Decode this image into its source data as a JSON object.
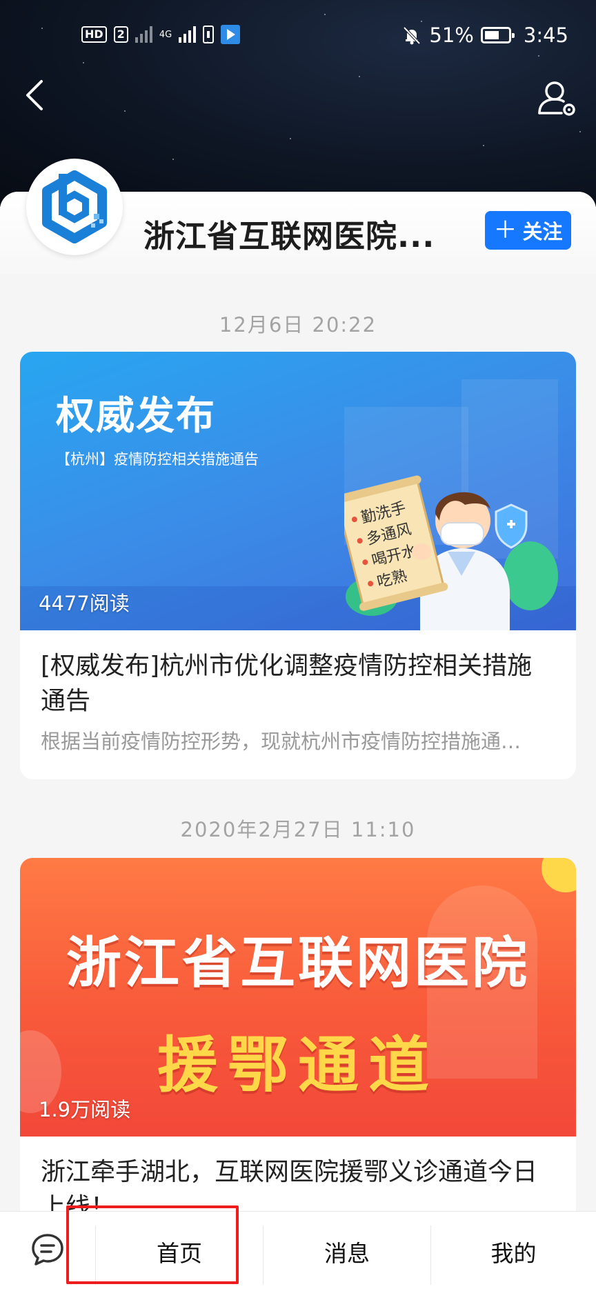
{
  "status_bar": {
    "network_labels": [
      "HD",
      "2",
      "4G"
    ],
    "battery": "51%",
    "time": "3:45"
  },
  "header": {
    "back_icon": "chevron-left-icon",
    "user_settings_icon": "user-settings-icon"
  },
  "account": {
    "name": "浙江省互联网医院...",
    "follow_label": "关注",
    "follow_icon": "plus-icon",
    "accent_color": "#1677ff"
  },
  "feed": [
    {
      "timestamp": "12月6日 20:22",
      "image_headline": "权威发布",
      "image_subline": "【杭州】疫情防控相关措施通告",
      "image_scroll_lines": [
        "勤洗手",
        "多通风",
        "喝开水",
        "吃熟"
      ],
      "read_count": "4477阅读",
      "title": "[权威发布]杭州市优化调整疫情防控相关措施通告",
      "summary": "根据当前疫情防控形势，现就杭州市疫情防控措施通…"
    },
    {
      "timestamp": "2020年2月27日 11:10",
      "image_headline": "浙江省互联网医院",
      "image_subline": "援鄂通道",
      "read_count": "1.9万阅读",
      "title": "浙江牵手湖北，互联网医院援鄂义诊通道今日上线！"
    }
  ],
  "bottom_nav": {
    "chat_icon": "chat-bubble-icon",
    "items": [
      "首页",
      "消息",
      "我的"
    ],
    "highlight_color": "#ee1c1c"
  }
}
